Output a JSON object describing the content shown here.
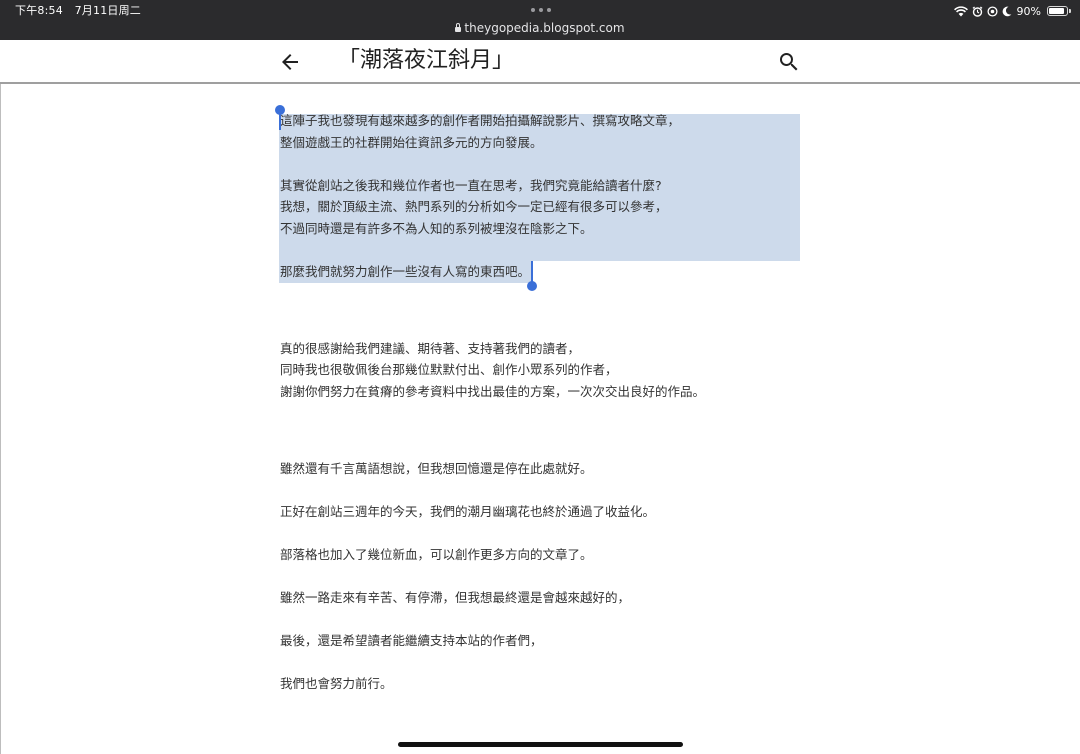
{
  "status_bar": {
    "time": "下午8:54",
    "date": "7月11日周二",
    "url": "theygopedia.blogspot.com",
    "battery_percent_label": "90%",
    "battery_level": 0.9,
    "icons": [
      "wifi-icon",
      "alarm-icon",
      "focus-icon",
      "moon-icon",
      "battery-icon"
    ]
  },
  "app_bar": {
    "back_icon": "arrow-left-icon",
    "title": "「潮落夜江斜月」",
    "search_icon": "search-icon"
  },
  "article": {
    "paragraphs": [
      {
        "lines": [
          "這陣子我也發現有越來越多的創作者開始拍攝解說影片、撰寫攻略文章，",
          "整個遊戲王的社群開始往資訊多元的方向發展。"
        ]
      },
      {
        "lines": [
          "其實從創站之後我和幾位作者也一直在思考，我們究竟能給讀者什麼?",
          "我想，關於頂級主流、熱門系列的分析如今一定已經有很多可以參考，",
          "不過同時還是有許多不為人知的系列被埋沒在陰影之下。"
        ]
      },
      {
        "lines": [
          "那麼我們就努力創作一些沒有人寫的東西吧。"
        ]
      },
      {
        "lines": [
          "真的很感謝給我們建議、期待著、支持著我們的讀者，",
          "同時我也很敬佩後台那幾位默默付出、創作小眾系列的作者，",
          "謝謝你們努力在貧瘠的參考資料中找出最佳的方案，一次次交出良好的作品。"
        ]
      },
      {
        "lines": [
          "雖然還有千言萬語想說，但我想回憶還是停在此處就好。"
        ]
      },
      {
        "lines": [
          "正好在創站三週年的今天，我們的潮月幽璃花也終於通過了收益化。"
        ]
      },
      {
        "lines": [
          "部落格也加入了幾位新血，可以創作更多方向的文章了。"
        ]
      },
      {
        "lines": [
          "雖然一路走來有辛苦、有停滯，但我想最終還是會越來越好的，"
        ]
      },
      {
        "lines": [
          "最後，還是希望讀者能繼續支持本站的作者們，"
        ]
      },
      {
        "lines": [
          "我們也會努力前行。"
        ]
      }
    ]
  },
  "colors": {
    "status_bar_bg": "#2b2b2d",
    "selection_highlight": "#cddaeb",
    "selection_handle": "#3a6fd8",
    "body_text": "#333333"
  }
}
